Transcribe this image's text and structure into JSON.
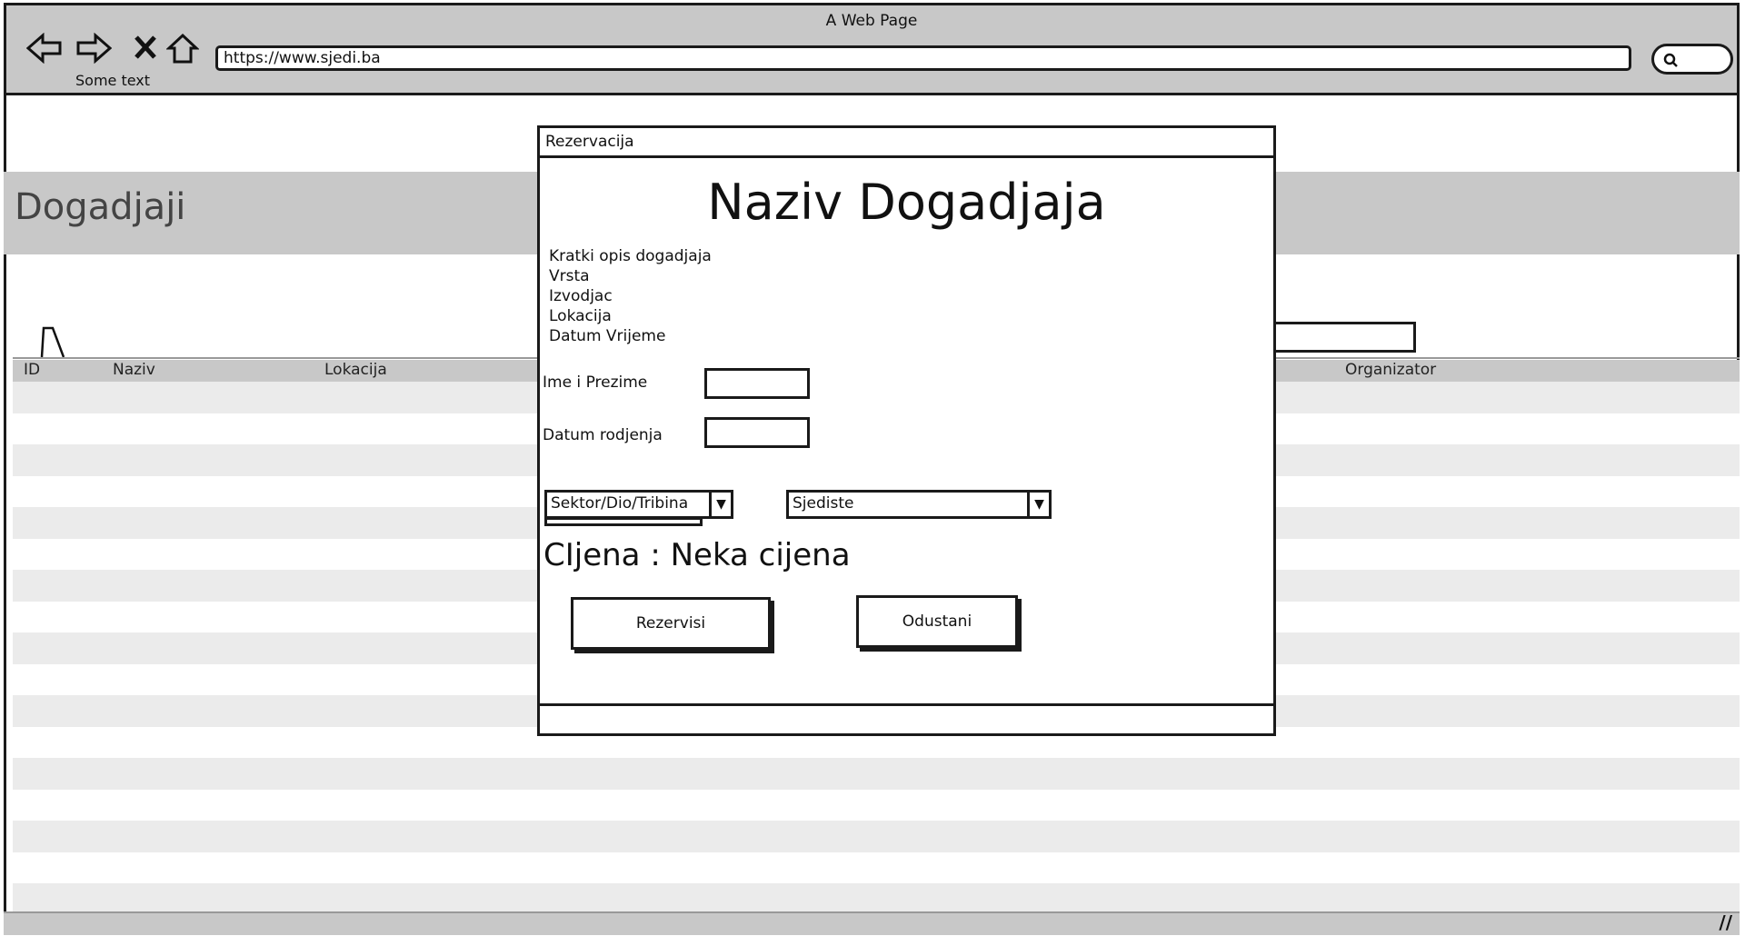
{
  "browser": {
    "window_title": "A Web Page",
    "url": "https://www.sjedi.ba",
    "subtext": "Some text",
    "icons": [
      "back-arrow-icon",
      "forward-arrow-icon",
      "close-x-icon",
      "home-icon",
      "search-icon"
    ]
  },
  "page": {
    "title": "Dogadjaji",
    "table": {
      "columns": [
        "ID",
        "Naziv",
        "Lokacija",
        "Organizator"
      ],
      "rows": []
    }
  },
  "modal": {
    "title": "Rezervacija",
    "event_name": "Naziv Dogadjaja",
    "info_lines": [
      "Kratki opis dogadjaja",
      "Vrsta",
      "Izvodjac",
      "Lokacija",
      "Datum Vrijeme"
    ],
    "name_label": "Ime i Prezime",
    "dob_label": "Datum rodjenja",
    "sector_select": "Sektor/Dio/Tribina",
    "seat_select": "Sjediste",
    "price": "CIjena : Neka cijena",
    "reserve_button": "Rezervisi",
    "cancel_button": "Odustani"
  }
}
